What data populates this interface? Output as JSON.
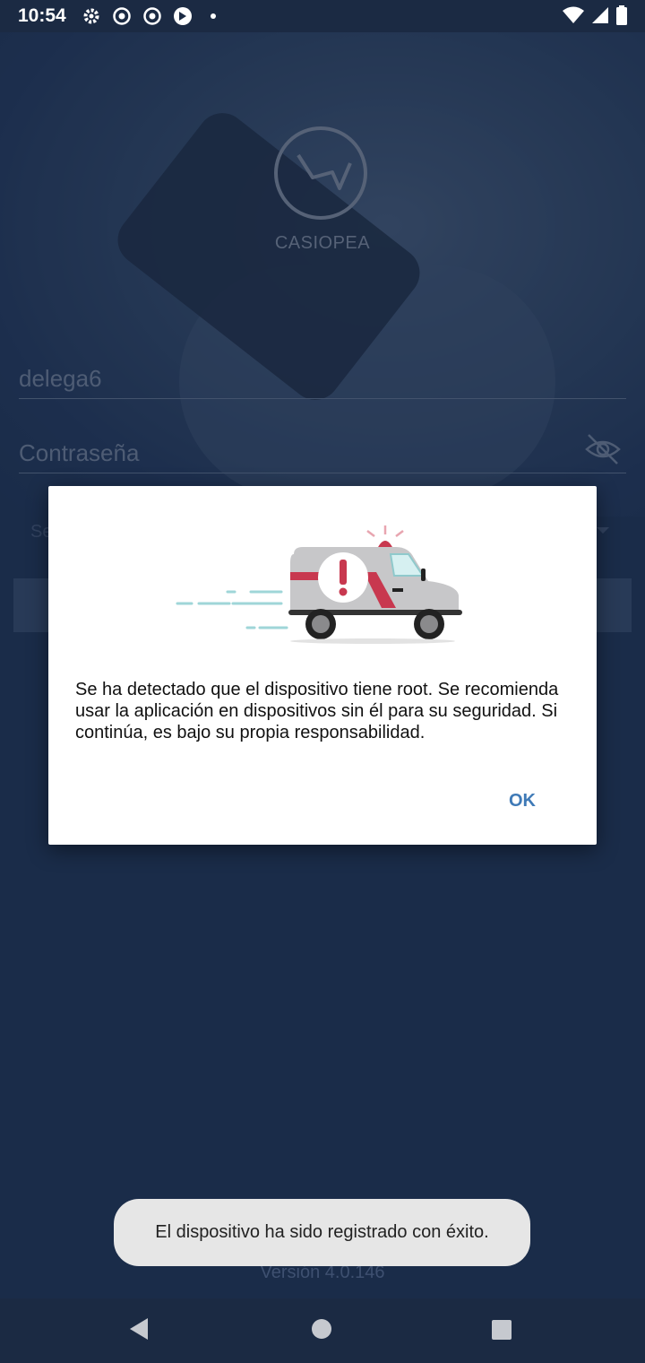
{
  "status_bar": {
    "time": "10:54",
    "left_icons": [
      "gear-icon",
      "chrome-icon",
      "chrome-icon",
      "sync-icon",
      "dot-icon"
    ],
    "right_icons": [
      "wifi-icon",
      "signal-icon",
      "battery-icon"
    ]
  },
  "app": {
    "name": "CASIOPEA",
    "username_value": "delega6",
    "password_placeholder": "Contraseña",
    "select_hint": "Se",
    "version": "Versión 4.0.146"
  },
  "dialog": {
    "message": "Se ha detectado que el dispositivo tiene root. Se recomienda usar la aplicación en dispositivos sin él para su seguridad. Si continúa, es bajo su propia responsabilidad.",
    "ok_label": "OK",
    "illustration": "ambulance-warning-icon"
  },
  "toast": {
    "message": "El dispositivo ha sido registrado con éxito."
  },
  "colors": {
    "background": "#1f3352",
    "accent": "#3f7ab7",
    "alert_red": "#c8384f"
  }
}
